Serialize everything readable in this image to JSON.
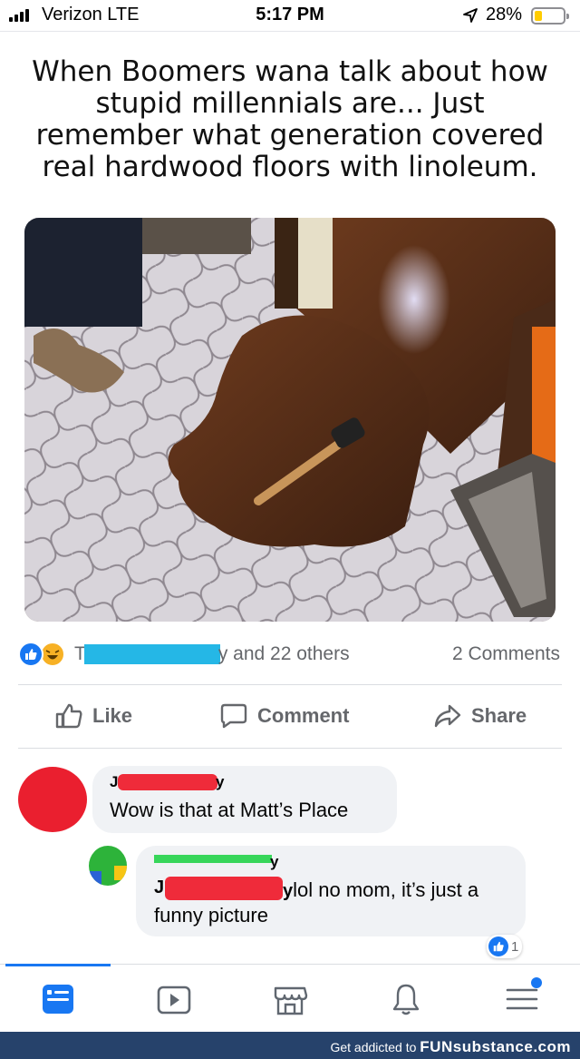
{
  "status_bar": {
    "carrier": "Verizon  LTE",
    "time": "5:17 PM",
    "battery_percent": "28%",
    "battery_level": 0.28,
    "icons": [
      "signal-icon",
      "location-arrow-icon",
      "battery-icon"
    ]
  },
  "post": {
    "caption": "When Boomers wana talk about how stupid millennials are... Just remember what generation covered real hardwood floors with linoleum."
  },
  "reactions": {
    "name_start": "T",
    "name_end": "y",
    "count_text": " and 22 others",
    "comments_count": "2 Comments",
    "icons": [
      "like-reaction-icon",
      "haha-reaction-icon"
    ]
  },
  "actions": {
    "like": "Like",
    "comment": "Comment",
    "share": "Share"
  },
  "comments": [
    {
      "author_start": "J",
      "author_end": "y",
      "text": "Wow is that at Matt’s Place"
    },
    {
      "author_start": "J",
      "author_end": "y",
      "text_line1": "lol no mom, it’s just a",
      "text_line2": "funny picture",
      "like_count": "1"
    }
  ],
  "bottom_nav": {
    "items": [
      "home-icon",
      "watch-icon",
      "marketplace-icon",
      "notifications-icon",
      "menu-icon"
    ],
    "active": "home-icon"
  },
  "watermark": {
    "prefix": "Get addicted to ",
    "brand": "FUNsubstance.com"
  },
  "colors": {
    "facebook_blue": "#1877f2",
    "secondary_text": "#65676b",
    "bubble_bg": "#f0f2f5",
    "watermark_bg": "#26426b"
  }
}
